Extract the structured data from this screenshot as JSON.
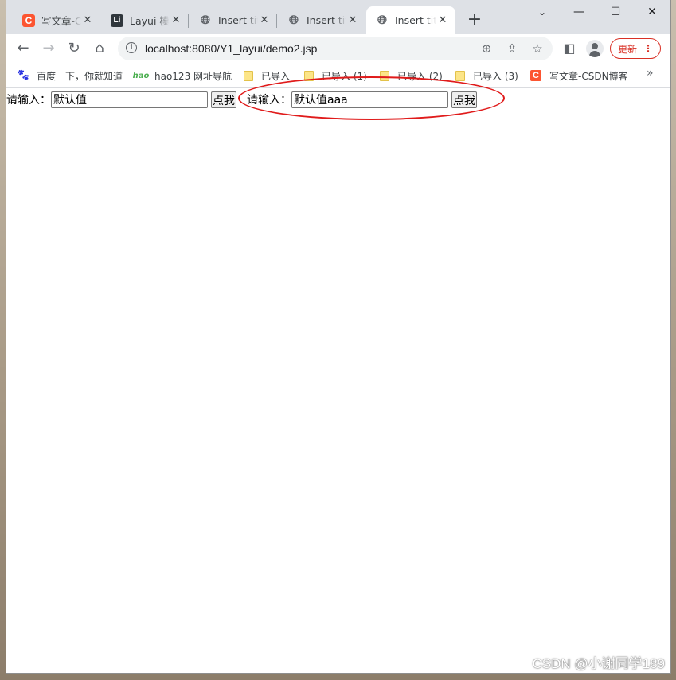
{
  "tabs": [
    {
      "title": "写文章-CSDN博客",
      "favicon": "csdn-icon",
      "active": false
    },
    {
      "title": "Layui 模块",
      "favicon": "layui-icon",
      "active": false
    },
    {
      "title": "Insert title here",
      "favicon": "globe-icon",
      "active": false
    },
    {
      "title": "Insert title here",
      "favicon": "globe-icon",
      "active": false
    },
    {
      "title": "Insert title here",
      "favicon": "globe-icon",
      "active": true
    }
  ],
  "toolbar": {
    "url": "localhost:8080/Y1_layui/demo2.jsp",
    "update_label": "更新"
  },
  "bookmarks": [
    {
      "label": "百度一下，你就知道",
      "icon": "baidu-paw-icon"
    },
    {
      "label": "hao123 网址导航",
      "icon": "hao123-icon"
    },
    {
      "label": "已导入",
      "icon": "folder-icon"
    },
    {
      "label": "已导入 (1)",
      "icon": "folder-icon"
    },
    {
      "label": "已导入 (2)",
      "icon": "folder-icon"
    },
    {
      "label": "已导入 (3)",
      "icon": "folder-icon"
    },
    {
      "label": "写文章-CSDN博客",
      "icon": "csdn-icon"
    }
  ],
  "page": {
    "form1": {
      "label": "请输入：",
      "value": "默认值",
      "button": "点我"
    },
    "form2": {
      "label": "请输入：",
      "value": "默认值aaa",
      "button": "点我"
    }
  },
  "watermark": "CSDN @小谢同学189",
  "colors": {
    "annotation": "#e01b1b",
    "csdn_brand": "#fc5531",
    "update_red": "#d93025"
  }
}
